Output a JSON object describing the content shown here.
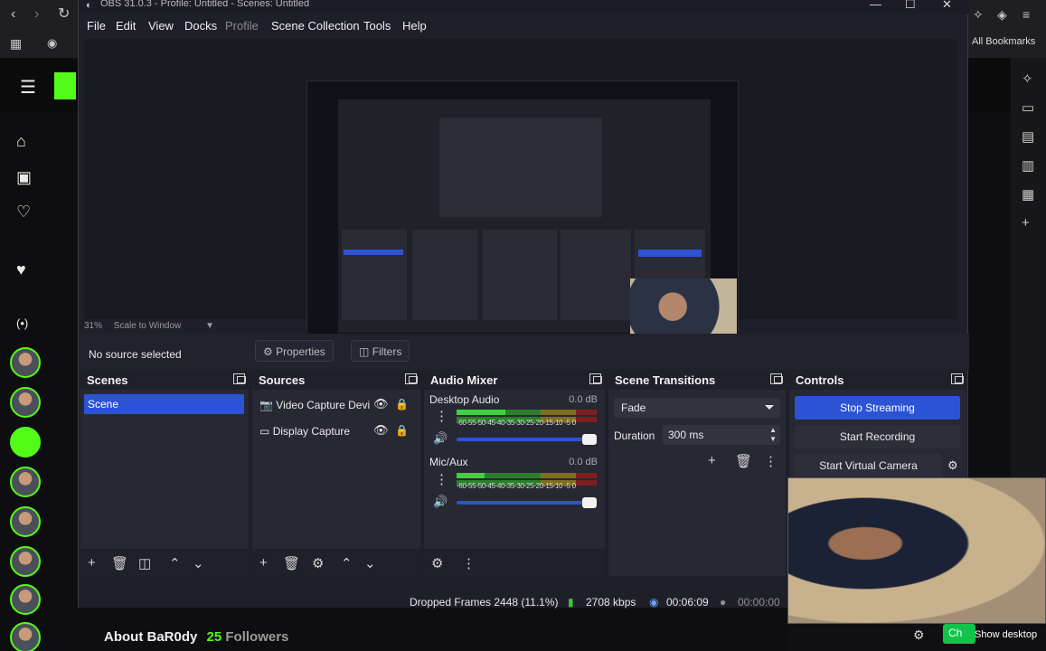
{
  "browser": {
    "bookmarks_label": "All Bookmarks",
    "nav_icons": [
      "back-icon",
      "forward-icon",
      "reload-icon",
      "apps-icon",
      "site-icon"
    ]
  },
  "page": {
    "about_name": "About BaR0dy",
    "followers_count": "25",
    "followers_label": "Followers"
  },
  "obs": {
    "title": "OBS 31.0.3 - Profile: Untitled - Scenes: Untitled",
    "menu": [
      "File",
      "Edit",
      "View",
      "Docks",
      "Profile",
      "Scene Collection",
      "Tools",
      "Help"
    ],
    "zoom": {
      "percent": "31%",
      "mode": "Scale to Window"
    },
    "context": {
      "no_source": "No source selected",
      "properties": "Properties",
      "filters": "Filters"
    },
    "scenes": {
      "title": "Scenes",
      "items": [
        "Scene"
      ]
    },
    "sources": {
      "title": "Sources",
      "items": [
        "Video Capture Devi",
        "Display Capture"
      ]
    },
    "mixer": {
      "title": "Audio Mixer",
      "channels": [
        {
          "name": "Desktop Audio",
          "db": "0.0 dB"
        },
        {
          "name": "Mic/Aux",
          "db": "0.0 dB"
        }
      ],
      "ticks": "-60-55-50-45-40-35-30-25-20-15-10 -5  0"
    },
    "transitions": {
      "title": "Scene Transitions",
      "selected": "Fade",
      "duration_label": "Duration",
      "duration_value": "300 ms"
    },
    "controls": {
      "title": "Controls",
      "stop_streaming": "Stop Streaming",
      "start_recording": "Start Recording",
      "start_virtual_camera": "Start Virtual Camera"
    },
    "status": {
      "dropped": "Dropped Frames 2448 (11.1%)",
      "bitrate": "2708 kbps",
      "stream_time": "00:06:09",
      "record_time": "00:00:00"
    }
  },
  "webcam": {
    "show_desktop": "Show desktop",
    "chat_button": "Ch"
  },
  "colors": {
    "accent": "#2d53d5",
    "kick_green": "#53fc18",
    "panel_bg": "#272833"
  }
}
